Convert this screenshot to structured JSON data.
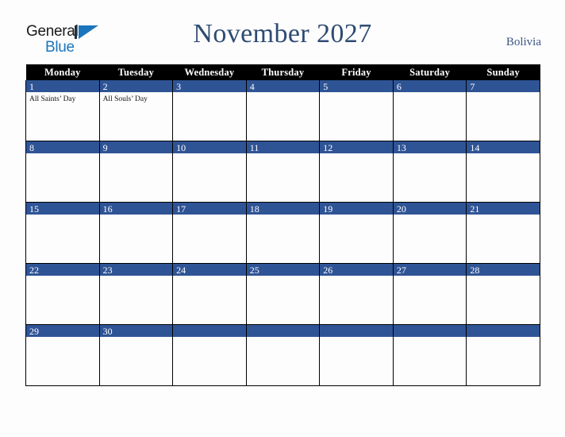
{
  "brand": {
    "name_part1": "General",
    "name_part2": "Blue",
    "triangle_icon": "triangle-icon"
  },
  "header": {
    "title": "November 2027",
    "country": "Bolivia"
  },
  "colors": {
    "day_bar": "#2f5496",
    "title": "#2e4b72",
    "header_row": "#000000",
    "brand_blue": "#1b75bc",
    "page_background": "#fdfdfd"
  },
  "calendar": {
    "weekday_headers": [
      "Monday",
      "Tuesday",
      "Wednesday",
      "Thursday",
      "Friday",
      "Saturday",
      "Sunday"
    ],
    "weeks": [
      [
        {
          "day": "1",
          "events": [
            "All Saints’ Day"
          ]
        },
        {
          "day": "2",
          "events": [
            "All Souls’ Day"
          ]
        },
        {
          "day": "3",
          "events": []
        },
        {
          "day": "4",
          "events": []
        },
        {
          "day": "5",
          "events": []
        },
        {
          "day": "6",
          "events": []
        },
        {
          "day": "7",
          "events": []
        }
      ],
      [
        {
          "day": "8",
          "events": []
        },
        {
          "day": "9",
          "events": []
        },
        {
          "day": "10",
          "events": []
        },
        {
          "day": "11",
          "events": []
        },
        {
          "day": "12",
          "events": []
        },
        {
          "day": "13",
          "events": []
        },
        {
          "day": "14",
          "events": []
        }
      ],
      [
        {
          "day": "15",
          "events": []
        },
        {
          "day": "16",
          "events": []
        },
        {
          "day": "17",
          "events": []
        },
        {
          "day": "18",
          "events": []
        },
        {
          "day": "19",
          "events": []
        },
        {
          "day": "20",
          "events": []
        },
        {
          "day": "21",
          "events": []
        }
      ],
      [
        {
          "day": "22",
          "events": []
        },
        {
          "day": "23",
          "events": []
        },
        {
          "day": "24",
          "events": []
        },
        {
          "day": "25",
          "events": []
        },
        {
          "day": "26",
          "events": []
        },
        {
          "day": "27",
          "events": []
        },
        {
          "day": "28",
          "events": []
        }
      ],
      [
        {
          "day": "29",
          "events": []
        },
        {
          "day": "30",
          "events": []
        },
        {
          "day": "",
          "events": []
        },
        {
          "day": "",
          "events": []
        },
        {
          "day": "",
          "events": []
        },
        {
          "day": "",
          "events": []
        },
        {
          "day": "",
          "events": []
        }
      ]
    ]
  }
}
